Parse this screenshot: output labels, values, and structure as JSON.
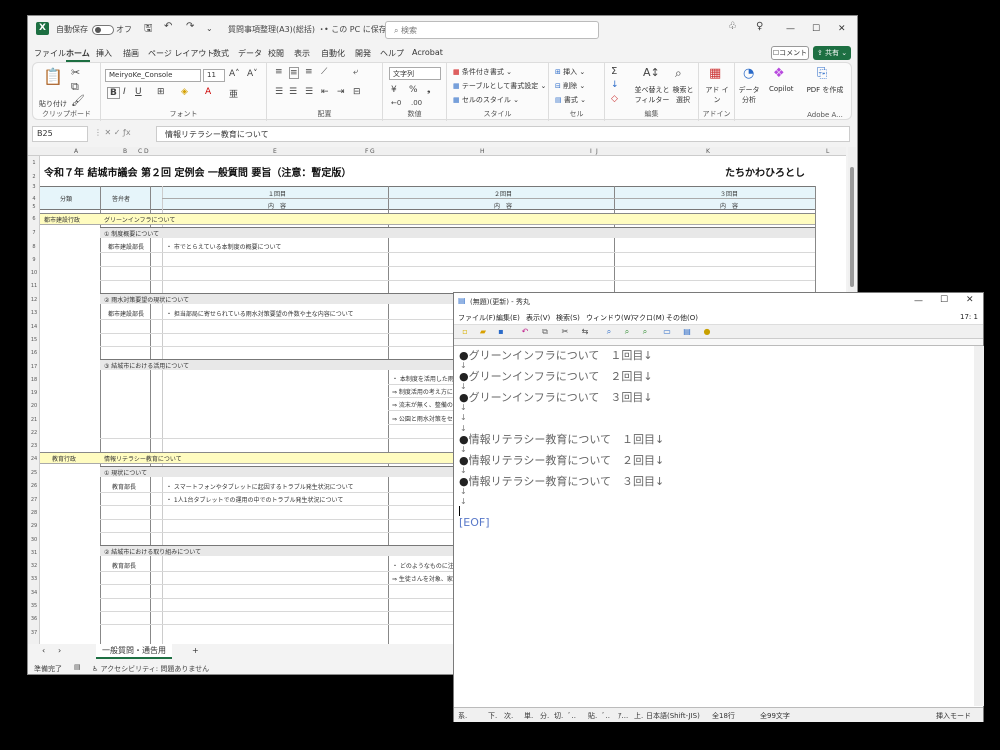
{
  "excel": {
    "autosave_label": "自動保存",
    "autosave_state": "オフ",
    "filename": "質問事項整理(A3)(総括) ・",
    "save_location": "この PC に保存済み",
    "search_placeholder": "検索",
    "menu": [
      "ファイル",
      "ホーム",
      "挿入",
      "描画",
      "ページ レイアウト",
      "数式",
      "データ",
      "校閲",
      "表示",
      "自動化",
      "開発",
      "ヘルプ",
      "Acrobat"
    ],
    "comment_label": "コメント",
    "share_label": "共有",
    "ribbon": {
      "paste": "貼り付け",
      "clipboard": "クリップボード",
      "font_name": "MeiryoKe_Console",
      "font_size": "11",
      "font_group": "フォント",
      "align_group": "配置",
      "number_format": "文字列",
      "number_group": "数値",
      "cond_format": "条件付き書式",
      "table_format": "テーブルとして書式設定",
      "cell_style": "セルのスタイル",
      "style_group": "スタイル",
      "insert": "挿入",
      "delete": "削除",
      "format": "書式",
      "cell_group": "セル",
      "sort_filter": "並べ替えと フィルター",
      "find_select": "検索と 選択",
      "edit_group": "編集",
      "addin": "アド イン",
      "addin_group": "アドイン",
      "data_analysis": "データ 分析",
      "copilot": "Copilot",
      "pdf": "PDF を作成",
      "adobe_group": "Adobe A..."
    },
    "name_box": "B25",
    "formula": "情報リテラシー教育について",
    "columns": [
      "A",
      "B",
      "C",
      "D",
      "E",
      "F",
      "G",
      "H",
      "I",
      "J",
      "K",
      "L"
    ],
    "sheet": {
      "title": "令和７年 結城市議会 第２回 定例会 一般質問 要旨（注意：暫定版）",
      "author": "たちかわひろとし",
      "h_category": "分類",
      "h_answerer": "答弁者",
      "round1": "１回目",
      "round2": "２回目",
      "round3": "３回目",
      "content": "内　容",
      "cat1": "都市建設行政",
      "topic1": "グリーンインフラについて",
      "sec1_1": "① 制度概要について",
      "ans1_1": "都市建設部長",
      "r1_1": "・ 市でとらえている本制度の概要について",
      "sec1_2": "② 雨水対策要望の現状について",
      "ans1_2": "都市建設部長",
      "r1_2": "・ 担当部局に寄せられている雨水対策要望の件数や主な内容について",
      "sec1_3": "③ 結城市における活用について",
      "r2_3a": "・ 本制度を活用した雨水対策整",
      "r2_3b": "⇒ 制度活用の考え方につい",
      "r2_3c": "⇒ 流末が無く、整備の難しい",
      "r2_3d": "⇒ 公園と雨水対策をセットに",
      "cat2": "教育行政",
      "topic2": "情報リテラシー教育について",
      "sec2_1": "① 現状について",
      "ans2_1": "教育部長",
      "r1_4a": "・ スマートフォンやタブレットに起因するトラブル発生状況について",
      "r1_4b": "・ 1人1台タブレットでの運用の中でのトラブル発生状況について",
      "sec2_2": "② 結城市における取り組みについて",
      "ans2_2": "教育部長",
      "r2_5a": "・ どのようなものに注力を置いて取",
      "r2_5b": "⇒ 生徒さんを対象、家庭を巻"
    },
    "row_numbers": [
      "1",
      "2",
      "3",
      "4",
      "5",
      "6",
      "7",
      "8",
      "9",
      "10",
      "11",
      "12",
      "13",
      "14",
      "15",
      "16",
      "17",
      "18",
      "19",
      "20",
      "21",
      "22",
      "23",
      "24",
      "25",
      "26",
      "27",
      "28",
      "29",
      "30",
      "31",
      "32",
      "33",
      "34",
      "35",
      "36",
      "37"
    ],
    "sheet_tab": "一般質問・通告用",
    "status_ready": "準備完了",
    "status_access": "アクセシビリティ: 問題ありません"
  },
  "hidemaru": {
    "title": "(無題)(更新) - 秀丸",
    "menu": [
      "ファイル(F)",
      "編集(E)",
      "表示(V)",
      "検索(S)",
      "ウィンドウ(W)",
      "マクロ(M)",
      "その他(O)"
    ],
    "cursor_pos": "17: 1",
    "lines": [
      {
        "bullet": "●",
        "text": "グリーンインフラについて　１回目↓"
      },
      {
        "bullet": "●",
        "text": "グリーンインフラについて　２回目↓"
      },
      {
        "bullet": "●",
        "text": "グリーンインフラについて　３回目↓"
      },
      {
        "bullet": "●",
        "text": "情報リテラシー教育について　１回目↓"
      },
      {
        "bullet": "●",
        "text": "情報リテラシー教育について　２回目↓"
      },
      {
        "bullet": "●",
        "text": "情報リテラシー教育について　３回目↓"
      }
    ],
    "return_mark": "↓",
    "eof": "[EOF]",
    "status": {
      "s1": "系.",
      "s2": "下.",
      "s3": "次.",
      "s4": "単.",
      "s5": "分.",
      "s6": "切.",
      "s7": "ﾞ..",
      "s8": "貼.",
      "s9": "ﾞ..",
      "s10": "ｱ...",
      "s11": "上.",
      "encoding": "日本語(Shift-JIS)",
      "line_count": "全18行",
      "char_count": "全99文字",
      "mode": "挿入モード"
    }
  }
}
